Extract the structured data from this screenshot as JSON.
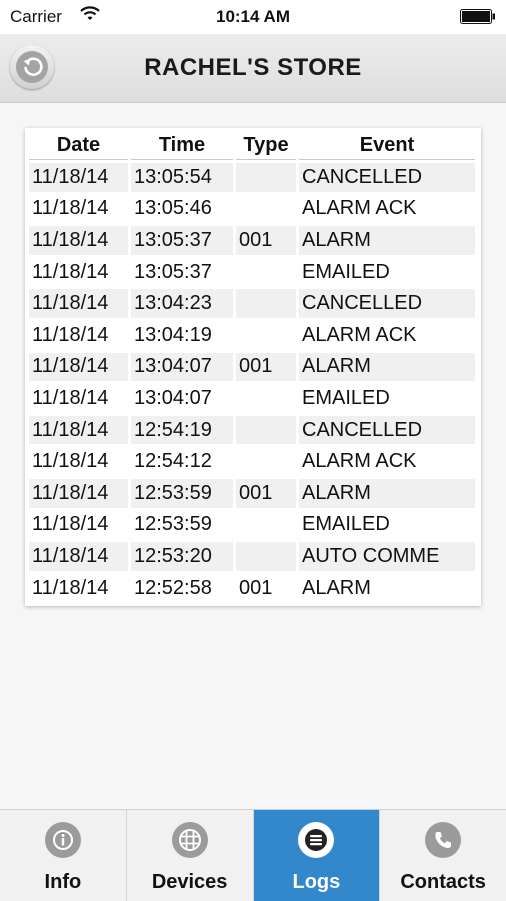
{
  "status_bar": {
    "carrier": "Carrier",
    "time": "10:14 AM"
  },
  "header": {
    "title": "RACHEL'S STORE",
    "back_icon": "back-arrow-icon"
  },
  "log_table": {
    "columns": [
      "Date",
      "Time",
      "Type",
      "Event"
    ],
    "rows": [
      [
        "11/18/14",
        "13:05:54",
        "",
        "CANCELLED"
      ],
      [
        "11/18/14",
        "13:05:46",
        "",
        "ALARM ACK"
      ],
      [
        "11/18/14",
        "13:05:37",
        "001",
        "ALARM"
      ],
      [
        "11/18/14",
        "13:05:37",
        "",
        "EMAILED"
      ],
      [
        "11/18/14",
        "13:04:23",
        "",
        "CANCELLED"
      ],
      [
        "11/18/14",
        "13:04:19",
        "",
        "ALARM ACK"
      ],
      [
        "11/18/14",
        "13:04:07",
        "001",
        "ALARM"
      ],
      [
        "11/18/14",
        "13:04:07",
        "",
        "EMAILED"
      ],
      [
        "11/18/14",
        "12:54:19",
        "",
        "CANCELLED"
      ],
      [
        "11/18/14",
        "12:54:12",
        "",
        "ALARM ACK"
      ],
      [
        "11/18/14",
        "12:53:59",
        "001",
        "ALARM"
      ],
      [
        "11/18/14",
        "12:53:59",
        "",
        "EMAILED"
      ],
      [
        "11/18/14",
        "12:53:20",
        "",
        "AUTO COMME"
      ],
      [
        "11/18/14",
        "12:52:58",
        "001",
        "ALARM"
      ]
    ]
  },
  "tab_bar": {
    "tabs": [
      {
        "label": "Info",
        "icon": "info-icon",
        "active": false
      },
      {
        "label": "Devices",
        "icon": "grid-icon",
        "active": false
      },
      {
        "label": "Logs",
        "icon": "list-icon",
        "active": true
      },
      {
        "label": "Contacts",
        "icon": "phone-icon",
        "active": false
      }
    ]
  },
  "colors": {
    "accent": "#3388cc",
    "header_bg": "#e5e5e5",
    "stripe": "#f0f0f0"
  }
}
